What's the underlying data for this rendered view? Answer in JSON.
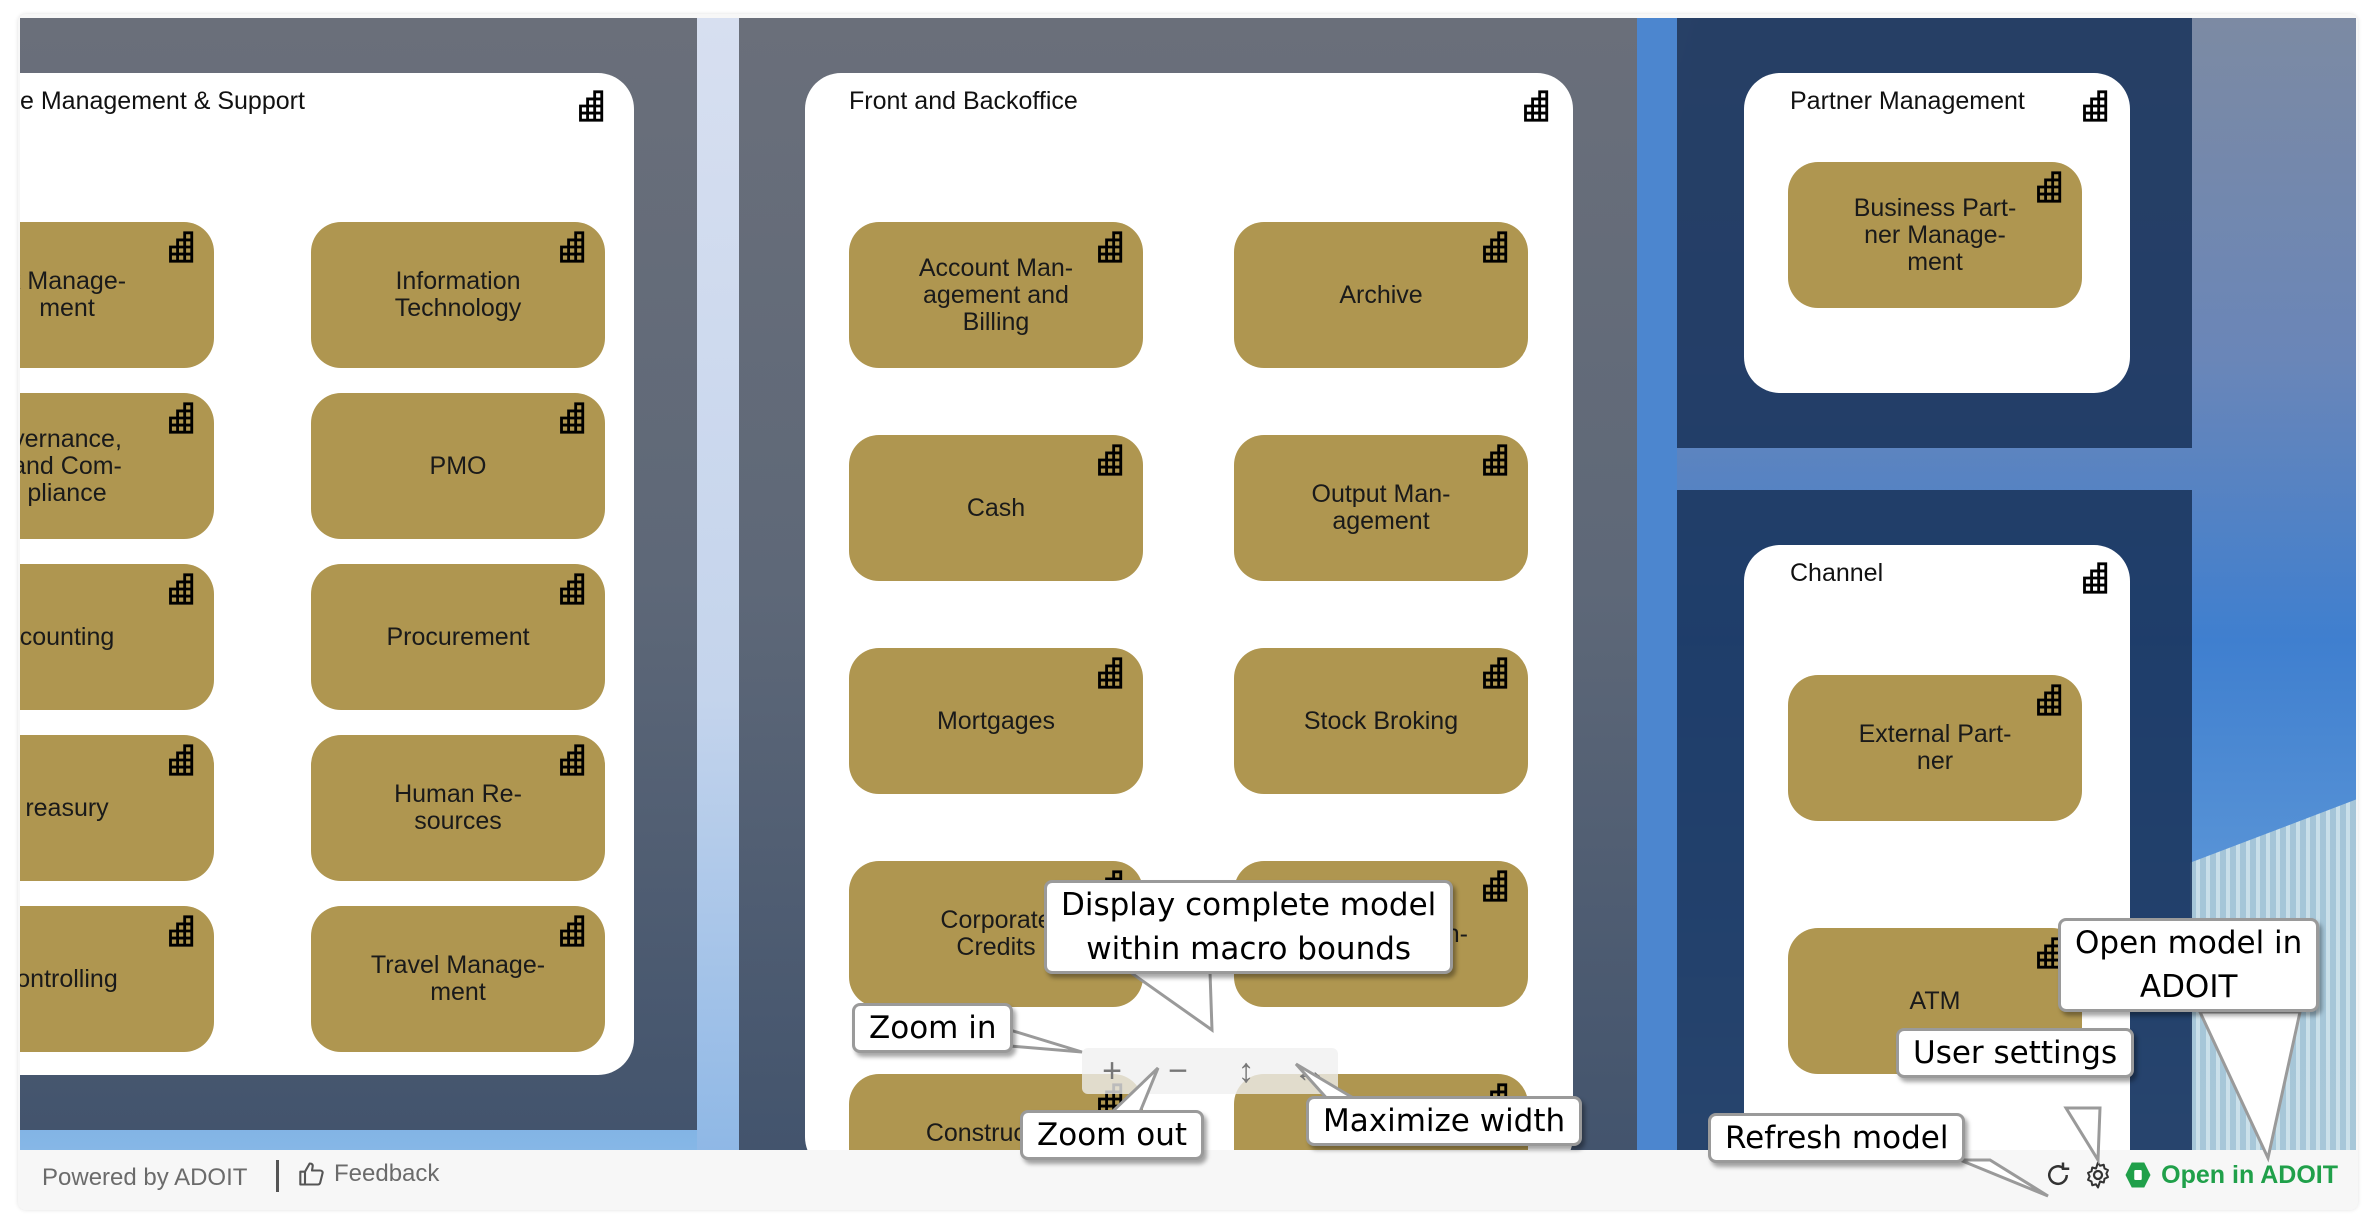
{
  "panels": {
    "support": {
      "title": "e Management & Support",
      "nodes": [
        {
          "label": "k Manage-\nment"
        },
        {
          "label": "Information\nTechnology"
        },
        {
          "label": "vernance,\n and Com-\npliance"
        },
        {
          "label": "PMO"
        },
        {
          "label": "counting"
        },
        {
          "label": "Procurement"
        },
        {
          "label": "reasury"
        },
        {
          "label": "Human Re-\nsources"
        },
        {
          "label": "ontrolling"
        },
        {
          "label": "Travel Manage-\nment"
        }
      ]
    },
    "front_backoffice": {
      "title": "Front and Backoffice",
      "nodes": [
        {
          "label": "Account Man-\nagement and\nBilling"
        },
        {
          "label": "Archive"
        },
        {
          "label": "Cash"
        },
        {
          "label": "Output Man-\nagement"
        },
        {
          "label": "Mortgages"
        },
        {
          "label": "Stock Broking"
        },
        {
          "label": "Corporate\nCredits"
        },
        {
          "label": "n-"
        },
        {
          "label": "Construction\nLoan"
        },
        {
          "label": ""
        }
      ]
    },
    "partner": {
      "title": "Partner Management",
      "nodes": [
        {
          "label": "Business Part-\nner Manage-\nment"
        }
      ]
    },
    "channel": {
      "title": "Channel",
      "nodes": [
        {
          "label": "External Part-\nner"
        },
        {
          "label": "ATM"
        }
      ]
    }
  },
  "zoom_controls": {
    "zoom_in": "+",
    "zoom_out": "−",
    "fit_height": "↕",
    "fit_width": "↔"
  },
  "footer": {
    "powered_by": "Powered by ADOIT",
    "feedback": "Feedback",
    "open_in_adoit": "Open in ADOIT"
  },
  "callouts": {
    "zoom_in": "Zoom in",
    "zoom_out": "Zoom out",
    "display_complete": "Display complete model\nwithin macro bounds",
    "maximize_width": "Maximize width",
    "refresh_model": "Refresh model",
    "user_settings": "User settings",
    "open_model": "Open model in\nADOIT"
  },
  "colors": {
    "node_fill": "#af9650",
    "open_adoit_green": "#20a04a",
    "panel_band_navy": "#1a345c"
  }
}
